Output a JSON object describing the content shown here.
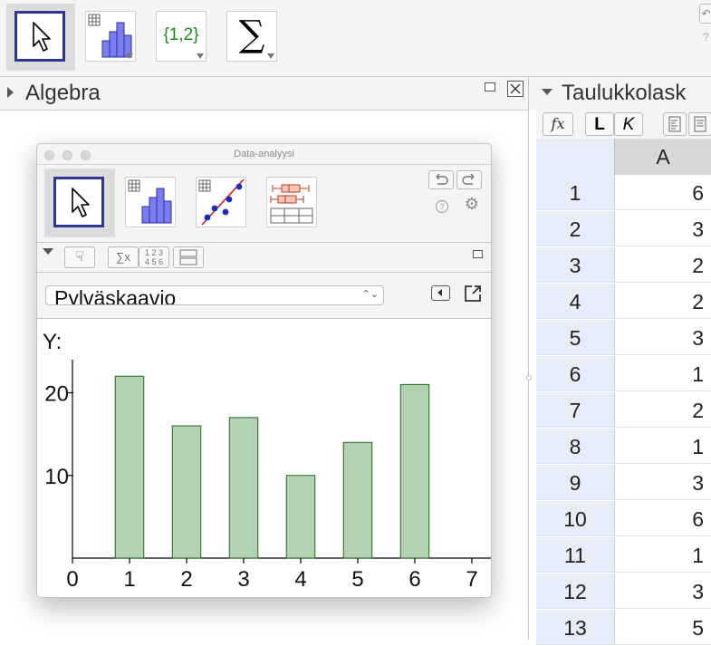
{
  "algebra_title": "Algebra",
  "sheet_title": "Taulukkolask",
  "toolbar_list_label": "{1,2}",
  "toolbar_sum_symbol": "∑",
  "data_window": {
    "title": "Data-analyysi",
    "chart_selector_value": "Pylväskaavio",
    "sum_label": "∑x",
    "grid_label_top": "1 2 3",
    "grid_label_bottom": "4 5 6"
  },
  "sheet": {
    "fx_label": "fx",
    "bold_label": "L",
    "italic_label": "K",
    "column_header": "A",
    "rows": [
      {
        "row": "1",
        "value": "6"
      },
      {
        "row": "2",
        "value": "3"
      },
      {
        "row": "3",
        "value": "2"
      },
      {
        "row": "4",
        "value": "2"
      },
      {
        "row": "5",
        "value": "3"
      },
      {
        "row": "6",
        "value": "1"
      },
      {
        "row": "7",
        "value": "2"
      },
      {
        "row": "8",
        "value": "1"
      },
      {
        "row": "9",
        "value": "3"
      },
      {
        "row": "10",
        "value": "6"
      },
      {
        "row": "11",
        "value": "1"
      },
      {
        "row": "12",
        "value": "3"
      },
      {
        "row": "13",
        "value": "5"
      }
    ]
  },
  "chart_data": {
    "type": "bar",
    "categories": [
      "1",
      "2",
      "3",
      "4",
      "5",
      "6"
    ],
    "values": [
      22,
      16,
      17,
      10,
      14,
      21
    ],
    "ylabel": "Y:",
    "xlim": [
      0,
      7
    ],
    "ylim": [
      0,
      24
    ],
    "x_ticks": [
      "0",
      "1",
      "2",
      "3",
      "4",
      "5",
      "6",
      "7"
    ],
    "y_ticks": [
      "10",
      "20"
    ],
    "bar_color": "#b3d1b3",
    "bar_edge_color": "#1c6b1c"
  }
}
